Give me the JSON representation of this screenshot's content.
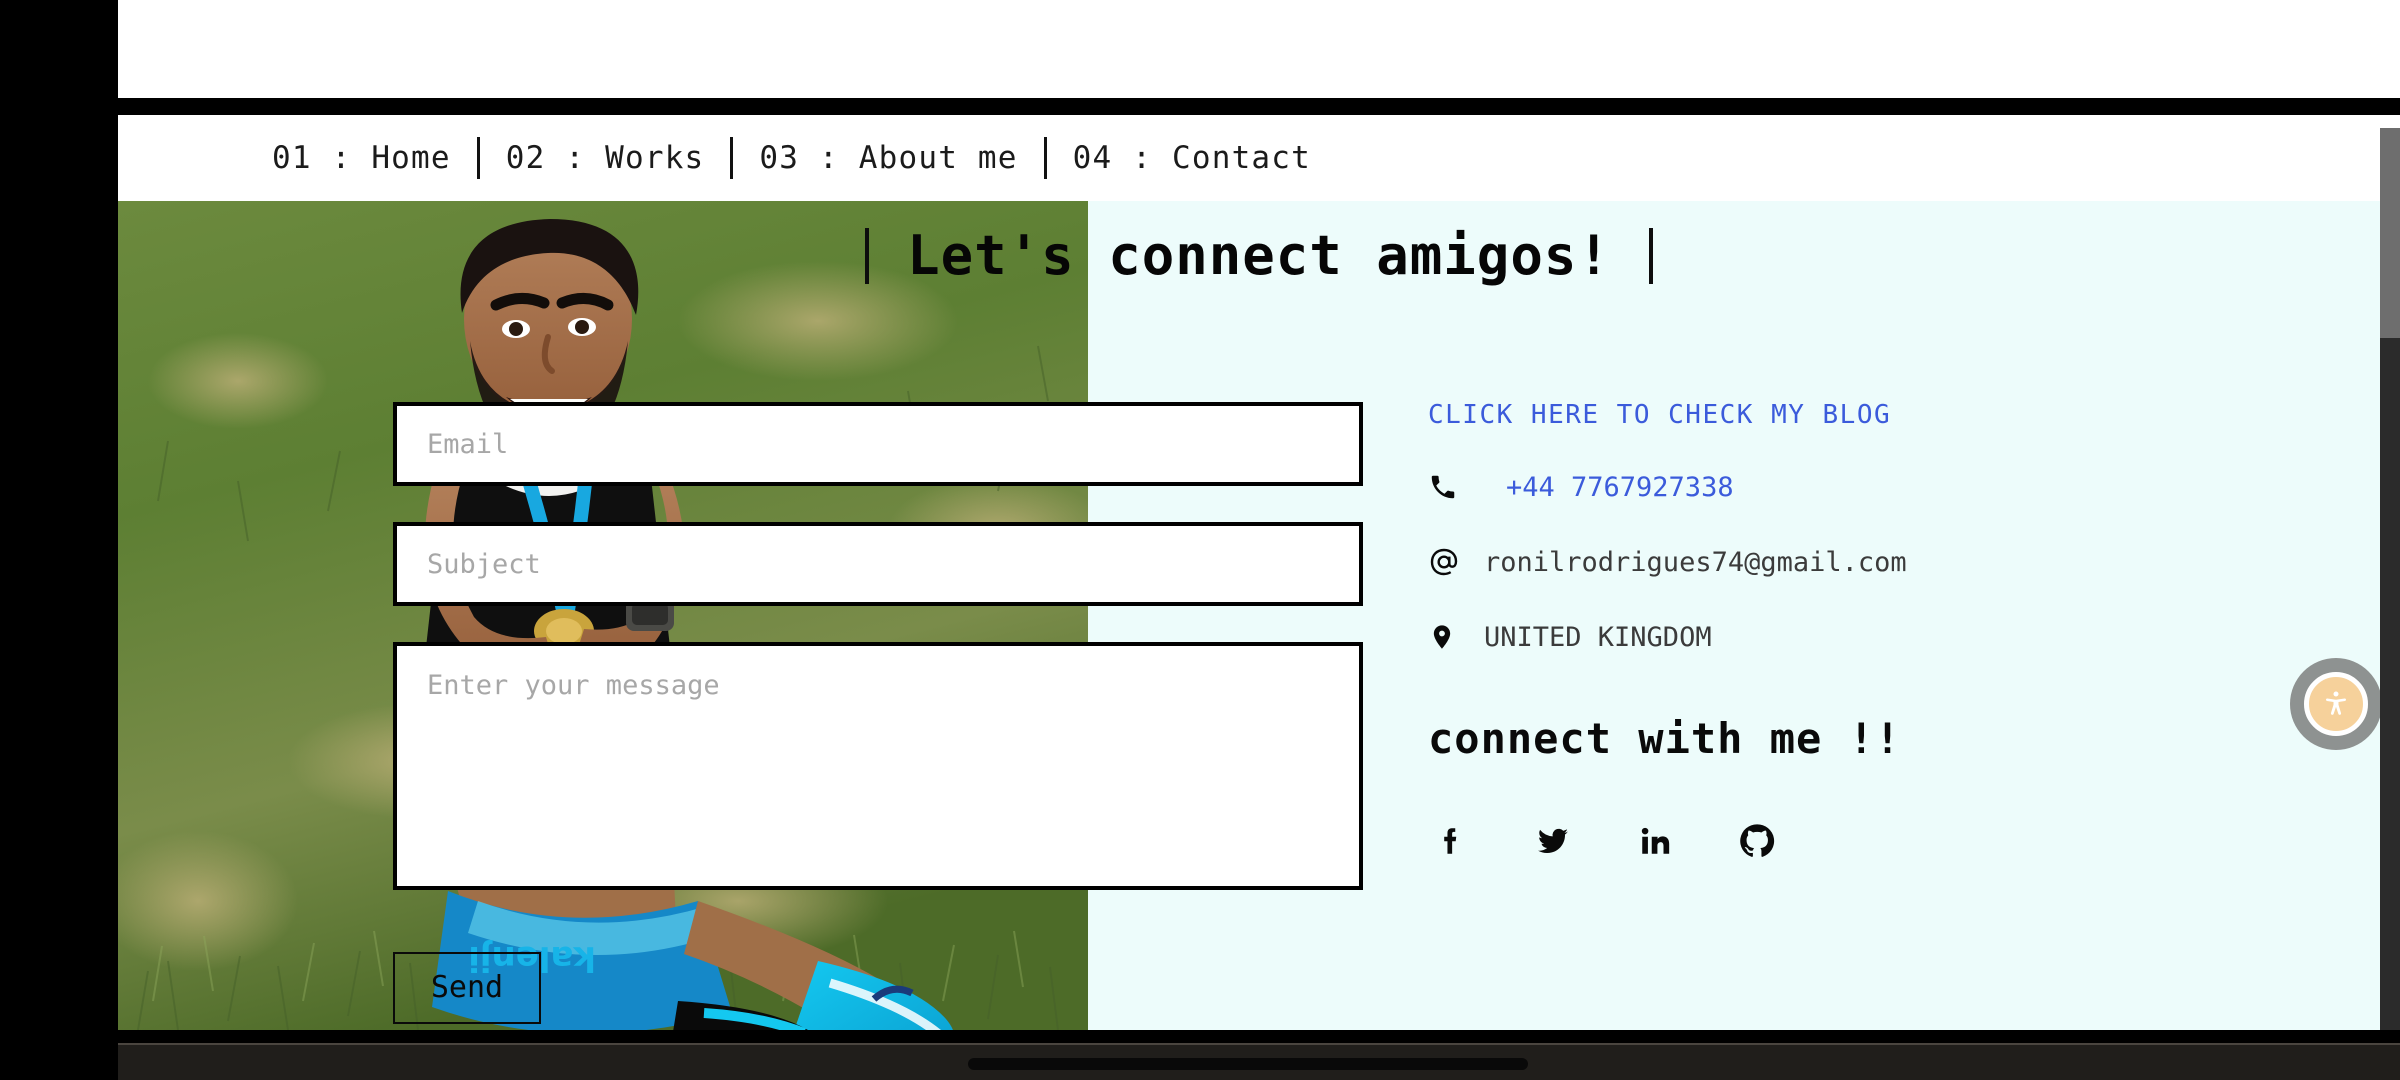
{
  "nav": {
    "items": [
      {
        "label": "01 : Home",
        "name": "nav-item-home"
      },
      {
        "label": "02 : Works",
        "name": "nav-item-works"
      },
      {
        "label": "03 : About me",
        "name": "nav-item-about-me"
      },
      {
        "label": "04 : Contact",
        "name": "nav-item-contact"
      }
    ]
  },
  "hero": {
    "heading": "Let's connect amigos!",
    "photo_alt": "Man in black tank top with race bib 123 sitting on grass"
  },
  "form": {
    "email_placeholder": "Email",
    "email_value": "",
    "subject_placeholder": "Subject",
    "subject_value": "",
    "message_placeholder": "Enter your message",
    "message_value": "",
    "send_label": "Send"
  },
  "info": {
    "blog_link": "CLICK HERE TO CHECK MY BLOG",
    "phone": "+44 7767927338",
    "email": "ronilrodrigues74@gmail.com",
    "location": "UNITED KINGDOM",
    "connect_title": "connect with me !!",
    "socials": [
      {
        "name": "facebook-icon",
        "label": "f"
      },
      {
        "name": "twitter-icon",
        "label": "twitter"
      },
      {
        "name": "linkedin-icon",
        "label": "in"
      },
      {
        "name": "github-icon",
        "label": "github"
      }
    ]
  },
  "widgets": {
    "accessibility_label": "Accessibility"
  },
  "colors": {
    "page_background": "#edfcfb",
    "navbar_background": "#ffffff",
    "link_blue": "#3b5bdb",
    "text_dark": "#0a0a0a",
    "placeholder_gray": "#a7a7a7",
    "a11y_accent": "#f6d19b",
    "a11y_ring": "#8e9291"
  }
}
